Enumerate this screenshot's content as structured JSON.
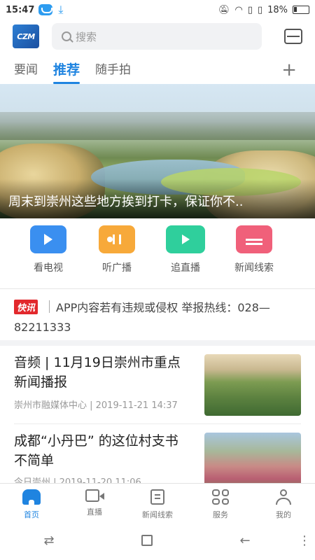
{
  "status": {
    "time": "15:47",
    "battery": "18%"
  },
  "header": {
    "logo_text": "CZM",
    "search_placeholder": "搜索"
  },
  "tabs": [
    {
      "label": "要闻",
      "active": false
    },
    {
      "label": "推荐",
      "active": true
    },
    {
      "label": "随手拍",
      "active": false
    }
  ],
  "tab_add": "+",
  "banner": {
    "caption": "周末到崇州这些地方挨到打卡，保证你不.."
  },
  "entries": [
    {
      "label": "看电视",
      "icon": "tv-icon",
      "color": "#3a8ff0"
    },
    {
      "label": "听广播",
      "icon": "radio-icon",
      "color": "#f7a93a"
    },
    {
      "label": "追直播",
      "icon": "live-camera-icon",
      "color": "#2fcf9c"
    },
    {
      "label": "新闻线索",
      "icon": "news-clue-icon",
      "color": "#f0607a"
    }
  ],
  "flash": {
    "tag": "快讯",
    "line1": "APP内容若有违规或侵权 举报热线：028—",
    "line2": "82211333"
  },
  "news": [
    {
      "title": "音频 | 11月19日崇州市重点新闻播报",
      "meta": "崇州市融媒体中心 | 2019-11-21 14:37"
    },
    {
      "title": "成都“小丹巴” 的这位村支书不简单",
      "meta": "今日崇州 | 2019-11-20 11:06"
    }
  ],
  "bottom_nav": [
    {
      "label": "首页",
      "active": true
    },
    {
      "label": "直播",
      "active": false
    },
    {
      "label": "新闻线索",
      "active": false
    },
    {
      "label": "服务",
      "active": false
    },
    {
      "label": "我的",
      "active": false
    }
  ],
  "colors": {
    "accent": "#1f84e0",
    "flash_red": "#e2282c"
  }
}
